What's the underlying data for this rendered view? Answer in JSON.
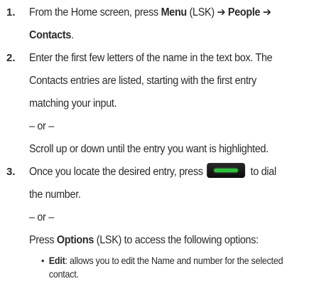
{
  "step1": {
    "number": "1.",
    "l1_pre": "From the Home screen, press ",
    "l1_menu": "Menu",
    "l1_mid": " (LSK) ",
    "l1_arrow1": "➔",
    "l1_people": " People ",
    "l1_arrow2": "➔",
    "l2_contacts": "Contacts",
    "l2_end": "."
  },
  "step2": {
    "number": "2.",
    "l1": "Enter the first few letters of the name in the text box. The",
    "l2": "Contacts entries are listed, starting with the first entry",
    "l3": "matching your input.",
    "or": "– or –",
    "alt": "Scroll up or down until the entry you want is highlighted."
  },
  "step3": {
    "number": "3.",
    "l1_pre": "Once you locate the desired entry, press",
    "l1_post": "to dial",
    "call_key_icon": "send-call-key-icon",
    "l2": "the number.",
    "or": "– or –",
    "l4_pre": "Press ",
    "l4_options": "Options",
    "l4_post": " (LSK) to access the following options:"
  },
  "bullet": {
    "marker": "•",
    "term": "Edit",
    "text1": ": allows you to edit the Name and number for the selected",
    "text2": "contact."
  }
}
